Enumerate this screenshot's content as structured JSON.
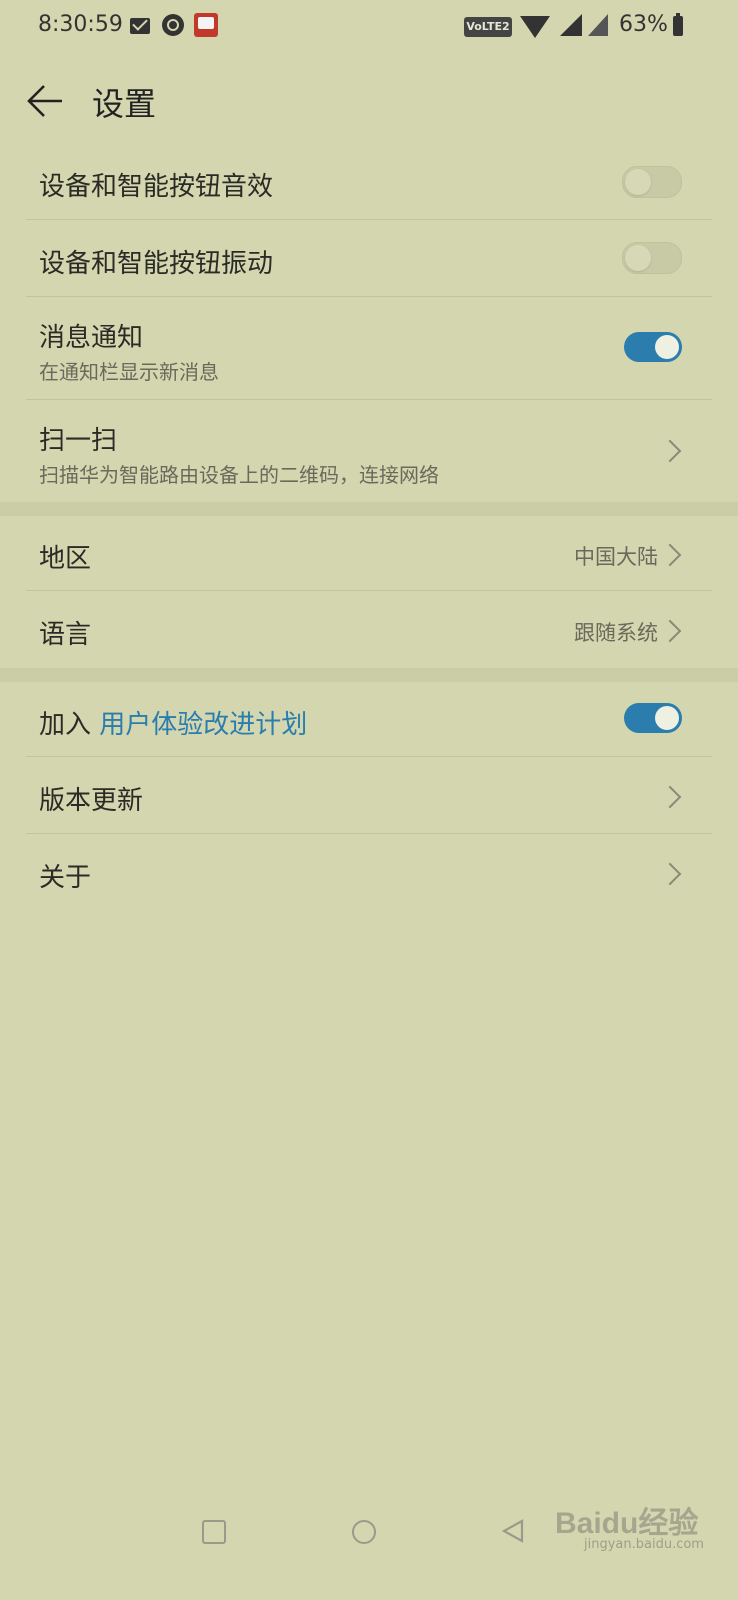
{
  "status_bar": {
    "time": "8:30:59",
    "volte": "VoLTE2",
    "battery": "63%"
  },
  "header": {
    "title": "设置"
  },
  "settings": {
    "device_sound": {
      "title": "设备和智能按钮音效",
      "enabled": false
    },
    "device_vibration": {
      "title": "设备和智能按钮振动",
      "enabled": false
    },
    "notification": {
      "title": "消息通知",
      "subtitle": "在通知栏显示新消息",
      "enabled": true
    },
    "scan": {
      "title": "扫一扫",
      "subtitle": "扫描华为智能路由设备上的二维码，连接网络"
    },
    "region": {
      "title": "地区",
      "value": "中国大陆"
    },
    "language": {
      "title": "语言",
      "value": "跟随系统"
    },
    "ux_program": {
      "prefix": "加入 ",
      "link": "用户体验改进计划",
      "enabled": true
    },
    "version_update": {
      "title": "版本更新"
    },
    "about": {
      "title": "关于"
    }
  },
  "watermark": {
    "brand": "Baidu经验",
    "url": "jingyan.baidu.com"
  },
  "colors": {
    "background": "#d4d6b0",
    "accent": "#2a7dad"
  }
}
